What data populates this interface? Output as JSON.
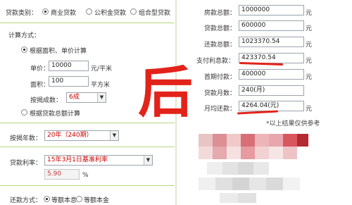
{
  "left": {
    "loan_type_label": "贷款类别：",
    "loan_types": [
      "商业贷款",
      "公积金贷款",
      "组合型贷款"
    ],
    "calc_method_label": "计算方式：",
    "method_by_area": "根据面积、单价计算",
    "unit_price_label": "单价：",
    "unit_price_value": "10000",
    "unit_price_unit": "元/平米",
    "area_label": "面积：",
    "area_value": "100",
    "area_unit": "平方米",
    "ratio_label": "按揭成数：",
    "ratio_value": "6成",
    "method_by_total": "根据贷款总额计算",
    "years_label": "按揭年数：",
    "years_value": "20年（240期）",
    "rate_label": "贷款利率：",
    "rate_select": "15年3月1日基准利率",
    "rate_value": "5.90",
    "rate_unit": "%",
    "repay_label": "还款方式：",
    "repay_options": [
      "等额本息",
      "等额本金"
    ]
  },
  "right": {
    "house_total_label": "房款总额：",
    "house_total_value": "1000000",
    "loan_total_label": "贷款总额：",
    "loan_total_value": "600000",
    "repay_total_label": "还款总额：",
    "repay_total_value": "1023370.54",
    "interest_label": "支付利息款：",
    "interest_value": "423370.54",
    "down_payment_label": "首期付款：",
    "down_payment_value": "400000",
    "months_label": "贷款月数：",
    "months_value": "240(月)",
    "monthly_label": "月均还款：",
    "monthly_value": "4264.04(元)",
    "yuan": "元",
    "note": "*以上结果仅供参考"
  },
  "overlay_text": "后",
  "colors": {
    "accent_red": "#e2231a",
    "separator_green": "#b8d67c"
  }
}
